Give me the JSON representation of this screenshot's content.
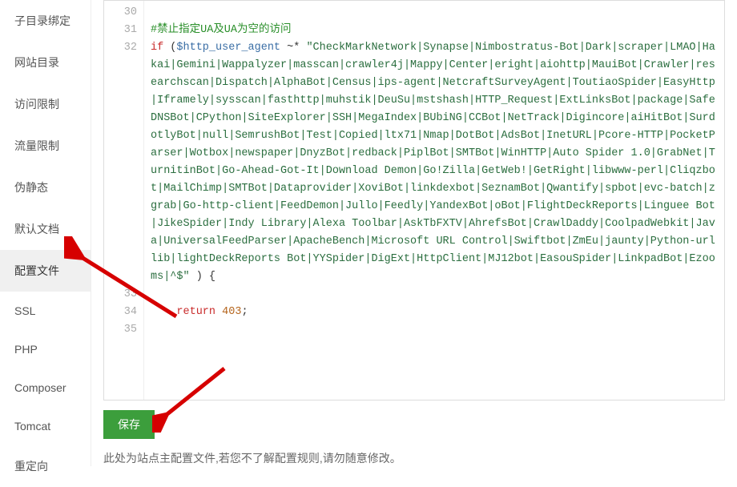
{
  "sidebar": {
    "items": [
      {
        "label": "子目录绑定"
      },
      {
        "label": "网站目录"
      },
      {
        "label": "访问限制"
      },
      {
        "label": "流量限制"
      },
      {
        "label": "伪静态"
      },
      {
        "label": "默认文档"
      },
      {
        "label": "配置文件",
        "active": true
      },
      {
        "label": "SSL"
      },
      {
        "label": "PHP"
      },
      {
        "label": "Composer"
      },
      {
        "label": "Tomcat"
      },
      {
        "label": "重定向"
      }
    ]
  },
  "editor": {
    "lines": [
      {
        "n": 30,
        "html": ""
      },
      {
        "n": 31,
        "html": "<span class='comment'>#禁止指定UA及UA为空的访问</span>"
      },
      {
        "n": 32,
        "html": "<span class='keyword'>if</span> (<span class='variable'>$http_user_agent</span> ~* <span class='string'>\"CheckMarkNetwork|Synapse|Nimbostratus-Bot|Dark|scraper|LMAO|Hakai|Gemini|Wappalyzer|masscan|crawler4j|Mappy|Center|eright|aiohttp|MauiBot|Crawler|researchscan|Dispatch|AlphaBot|Census|ips-agent|NetcraftSurveyAgent|ToutiaoSpider|EasyHttp|Iframely|sysscan|fasthttp|muhstik|DeuSu|mstshash|HTTP_Request|ExtLinksBot|package|SafeDNSBot|CPython|SiteExplorer|SSH|MegaIndex|BUbiNG|CCBot|NetTrack|Digincore|aiHitBot|SurdotlyBot|null|SemrushBot|Test|Copied|ltx71|Nmap|DotBot|AdsBot|InetURL|Pcore-HTTP|PocketParser|Wotbox|newspaper|DnyzBot|redback|PiplBot|SMTBot|WinHTTP|Auto Spider 1.0|GrabNet|TurnitinBot|Go-Ahead-Got-It|Download Demon|Go!Zilla|GetWeb!|GetRight|libwww-perl|Cliqzbot|MailChimp|SMTBot|Dataprovider|XoviBot|linkdexbot|SeznamBot|Qwantify|spbot|evc-batch|zgrab|Go-http-client|FeedDemon|Jullo|Feedly|YandexBot|oBot|FlightDeckReports|Linguee Bot|JikeSpider|Indy Library|Alexa Toolbar|AskTbFXTV|AhrefsBot|CrawlDaddy|CoolpadWebkit|Java|UniversalFeedParser|ApacheBench|Microsoft URL Control|Swiftbot|ZmEu|jaunty|Python-urllib|lightDeckReports Bot|YYSpider|DigExt|HttpClient|MJ12bot|EasouSpider|LinkpadBot|Ezooms|^$\"</span> ) {"
      },
      {
        "n": 33,
        "html": ""
      },
      {
        "n": 34,
        "html": "    <span class='keyword'>return</span> <span class='number'>403</span>;"
      },
      {
        "n": 35,
        "html": ""
      }
    ]
  },
  "save_btn": "保存",
  "note_text": "此处为站点主配置文件,若您不了解配置规则,请勿随意修改。"
}
